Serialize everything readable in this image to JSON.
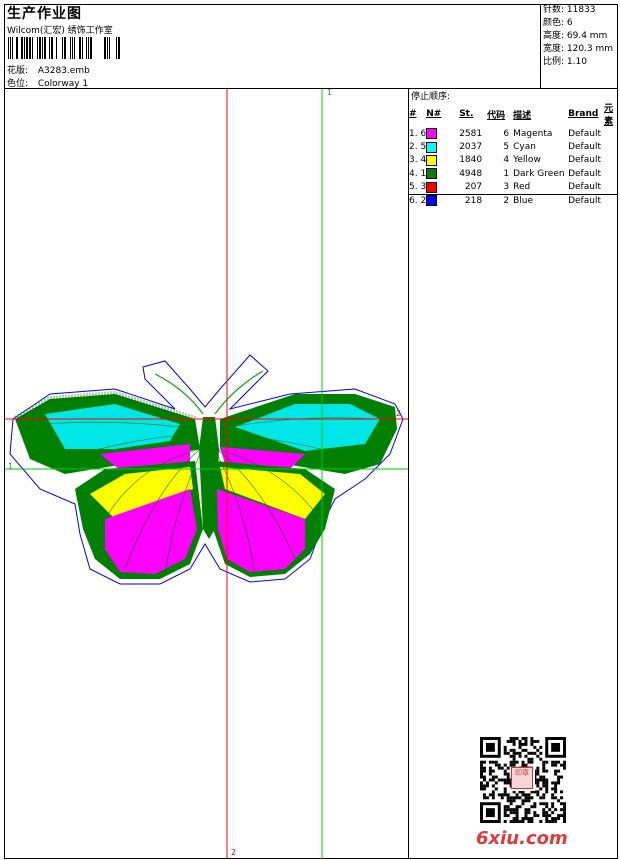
{
  "header": {
    "title": "生产作业图",
    "company": "Wilcom(汇宏) 绣饰工作室",
    "design_label": "花版:",
    "design_value": "A3283.emb",
    "colorway_label": "色位:",
    "colorway_value": "Colorway 1"
  },
  "stats": {
    "stitches": "针数: 11833",
    "colors": "颜色: 6",
    "height": "高度: 69.4 mm",
    "width": "宽度: 120.3 mm",
    "scale": "比例: 1.10"
  },
  "sequence": {
    "title": "停止顺序:",
    "headers": [
      "#",
      "N#",
      "St.",
      "代码",
      "描述",
      "Brand",
      "元素"
    ],
    "rows": [
      {
        "seq": "1. 6",
        "color": "#ff00ff",
        "stitches": "2581",
        "code": "6",
        "desc": "Magenta",
        "brand": "Default"
      },
      {
        "seq": "2. 5",
        "color": "#00ffff",
        "stitches": "2037",
        "code": "5",
        "desc": "Cyan",
        "brand": "Default"
      },
      {
        "seq": "3. 4",
        "color": "#ffff00",
        "stitches": "1840",
        "code": "4",
        "desc": "Yellow",
        "brand": "Default"
      },
      {
        "seq": "4. 1",
        "color": "#008000",
        "stitches": "4948",
        "code": "1",
        "desc": "Dark Green",
        "brand": "Default"
      },
      {
        "seq": "5. 3",
        "color": "#ff0000",
        "stitches": "207",
        "code": "3",
        "desc": "Red",
        "brand": "Default"
      },
      {
        "seq": "6. 2",
        "color": "#0000ff",
        "stitches": "218",
        "code": "2",
        "desc": "Blue",
        "brand": "Default"
      }
    ]
  },
  "guides": {
    "green_top": "1",
    "green_left": "1",
    "red_bottom": "2",
    "red_right": "2"
  },
  "watermark": "6xiu.com",
  "seal_text": "印章",
  "colors": {
    "red_guide": "#ff0000",
    "green_guide": "#00cc00",
    "outline": "#0000ff"
  }
}
